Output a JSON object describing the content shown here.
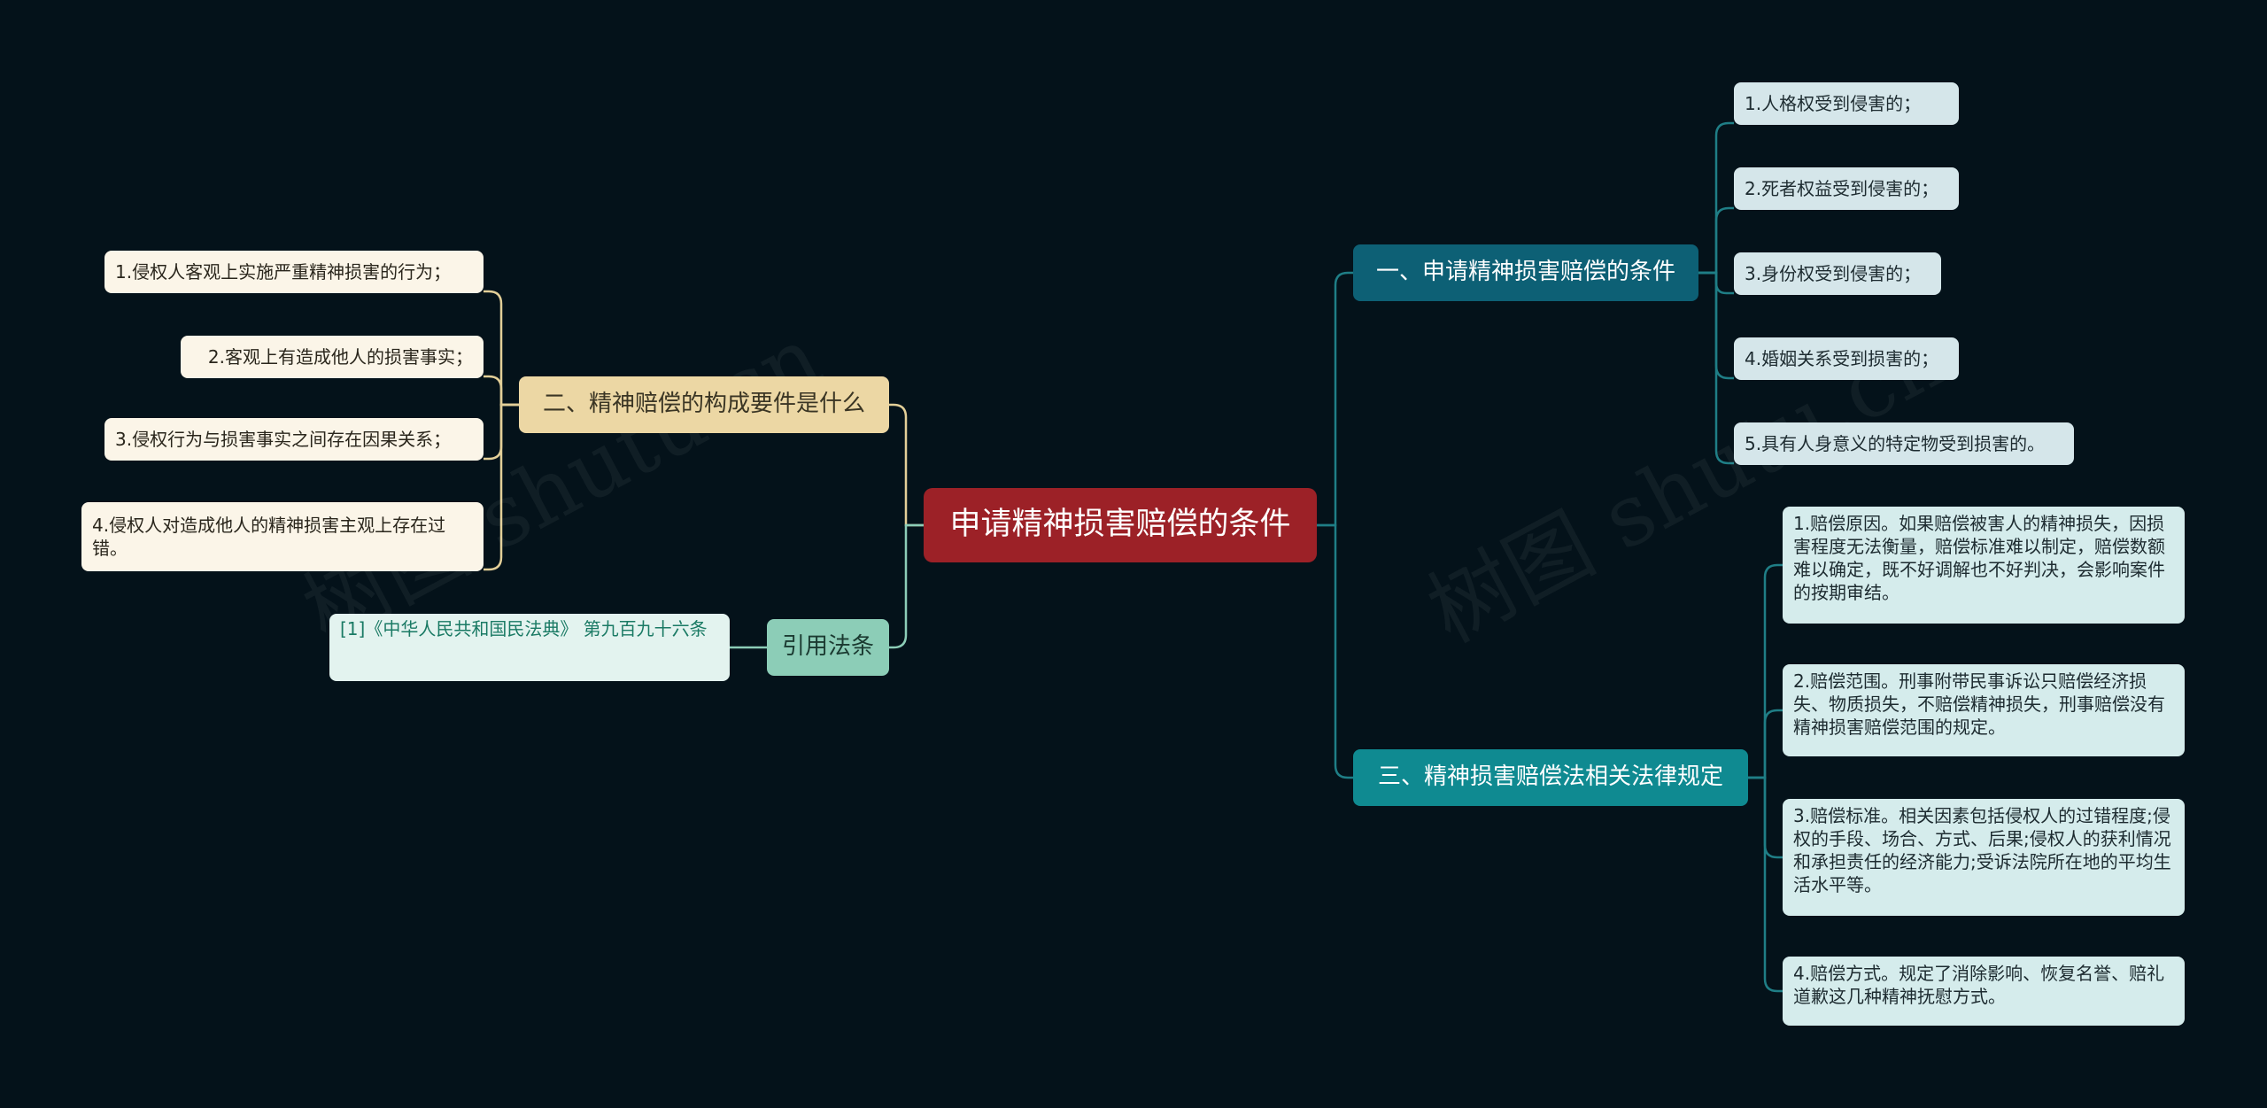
{
  "diagram": {
    "root": "申请精神损害赔偿的条件",
    "branch_conditions": {
      "title": "一、申请精神损害赔偿的条件",
      "items": [
        "1.人格权受到侵害的；",
        "2.死者权益受到侵害的；",
        "3.身份权受到侵害的；",
        "4.婚姻关系受到损害的；",
        "5.具有人身意义的特定物受到损害的。"
      ]
    },
    "branch_elements": {
      "title": "二、精神赔偿的构成要件是什么",
      "items": [
        "1.侵权人客观上实施严重精神损害的行为；",
        "2.客观上有造成他人的损害事实；",
        "3.侵权行为与损害事实之间存在因果关系；",
        "4.侵权人对造成他人的精神损害主观上存在过错。"
      ]
    },
    "branch_laws": {
      "title": "三、精神损害赔偿法相关法律规定",
      "items": [
        "1.赔偿原因。如果赔偿被害人的精神损失，因损害程度无法衡量，赔偿标准难以制定，赔偿数额难以确定，既不好调解也不好判决，会影响案件的按期审结。",
        "2.赔偿范围。刑事附带民事诉讼只赔偿经济损失、物质损失，不赔偿精神损失，刑事赔偿没有精神损害赔偿范围的规定。",
        "3.赔偿标准。相关因素包括侵权人的过错程度;侵权的手段、场合、方式、后果;侵权人的获利情况和承担责任的经济能力;受诉法院所在地的平均生活水平等。",
        "4.赔偿方式。规定了消除影响、恢复名誉、赔礼道歉这几种精神抚慰方式。"
      ]
    },
    "branch_cite": {
      "title": "引用法条",
      "items": [
        "[1]《中华人民共和国民法典》 第九百九十六条"
      ]
    },
    "watermark": "树图 shutu.cn",
    "colors": {
      "background": "#04121a",
      "root": "#9c2127",
      "branch_conditions": "#0d6075",
      "branch_laws": "#0f8a91",
      "branch_elements": "#ecd7a4",
      "branch_cite": "#8ccdb7",
      "line_teal": "#1f7e86",
      "line_gold": "#e3cf98",
      "line_mint": "#8ccdb7"
    }
  }
}
